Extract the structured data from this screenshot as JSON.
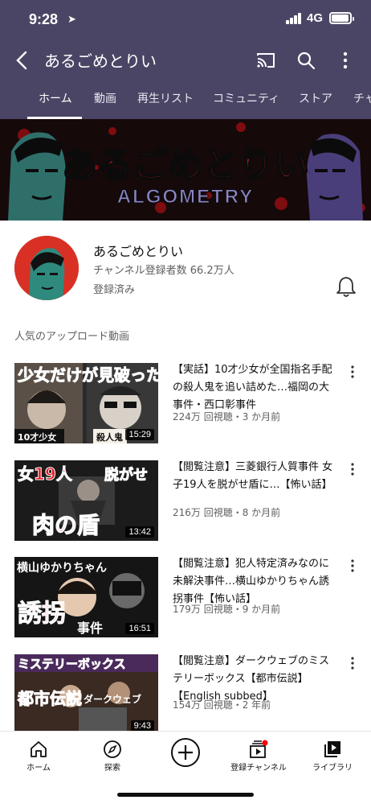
{
  "status_bar": {
    "time": "9:28",
    "network": "4G"
  },
  "app_bar": {
    "title": "あるごめとりい"
  },
  "tabs": [
    {
      "label": "ホーム"
    },
    {
      "label": "動画"
    },
    {
      "label": "再生リスト"
    },
    {
      "label": "コミュニティ"
    },
    {
      "label": "ストア"
    },
    {
      "label": "チャ"
    }
  ],
  "banner": {
    "title": "あるごめとりい",
    "subtitle": "ALGOMETRY"
  },
  "channel": {
    "name": "あるごめとりい",
    "subscribers": "チャンネル登録者数 66.2万人",
    "status": "登録済み"
  },
  "section_title": "人気のアップロード動画",
  "videos": [
    {
      "title": "【実話】10才少女が全国指名手配の殺人鬼を追い詰めた…福岡の大事件・西口彰事件",
      "meta": "224万 回視聴・3 か月前",
      "duration": "15:29",
      "thumb_text": [
        "少女だけが見破った",
        "10才少女",
        "殺人鬼"
      ]
    },
    {
      "title": "【閲覧注意】三菱銀行人質事件 女子19人を脱がせ盾に…【怖い話】",
      "meta": "216万 回視聴・8 か月前",
      "duration": "13:42",
      "thumb_text": [
        "女19人",
        "脱がせ",
        "肉の盾"
      ]
    },
    {
      "title": "【閲覧注意】犯人特定済みなのに未解決事件…横山ゆかりちゃん誘拐事件【怖い話】",
      "meta": "179万 回視聴・9 か月前",
      "duration": "16:51",
      "thumb_text": [
        "横山ゆかりちゃん",
        "誘拐",
        "事件"
      ]
    },
    {
      "title": "【閲覧注意】ダークウェブのミステリーボックス【都市伝説】【English subbed】",
      "meta": "154万 回視聴・2 年前",
      "duration": "9:43",
      "thumb_text": [
        "ミステリーボックス",
        "都市伝説",
        "ダークウェブ"
      ]
    }
  ],
  "bottom_nav": [
    {
      "label": "ホーム",
      "icon": "home-icon"
    },
    {
      "label": "探索",
      "icon": "explore-icon"
    },
    {
      "label": "",
      "icon": "create-icon"
    },
    {
      "label": "登録チャンネル",
      "icon": "subscriptions-icon"
    },
    {
      "label": "ライブラリ",
      "icon": "library-icon"
    }
  ],
  "colors": {
    "header": "#4b4565",
    "accent_red": "#d93025"
  }
}
